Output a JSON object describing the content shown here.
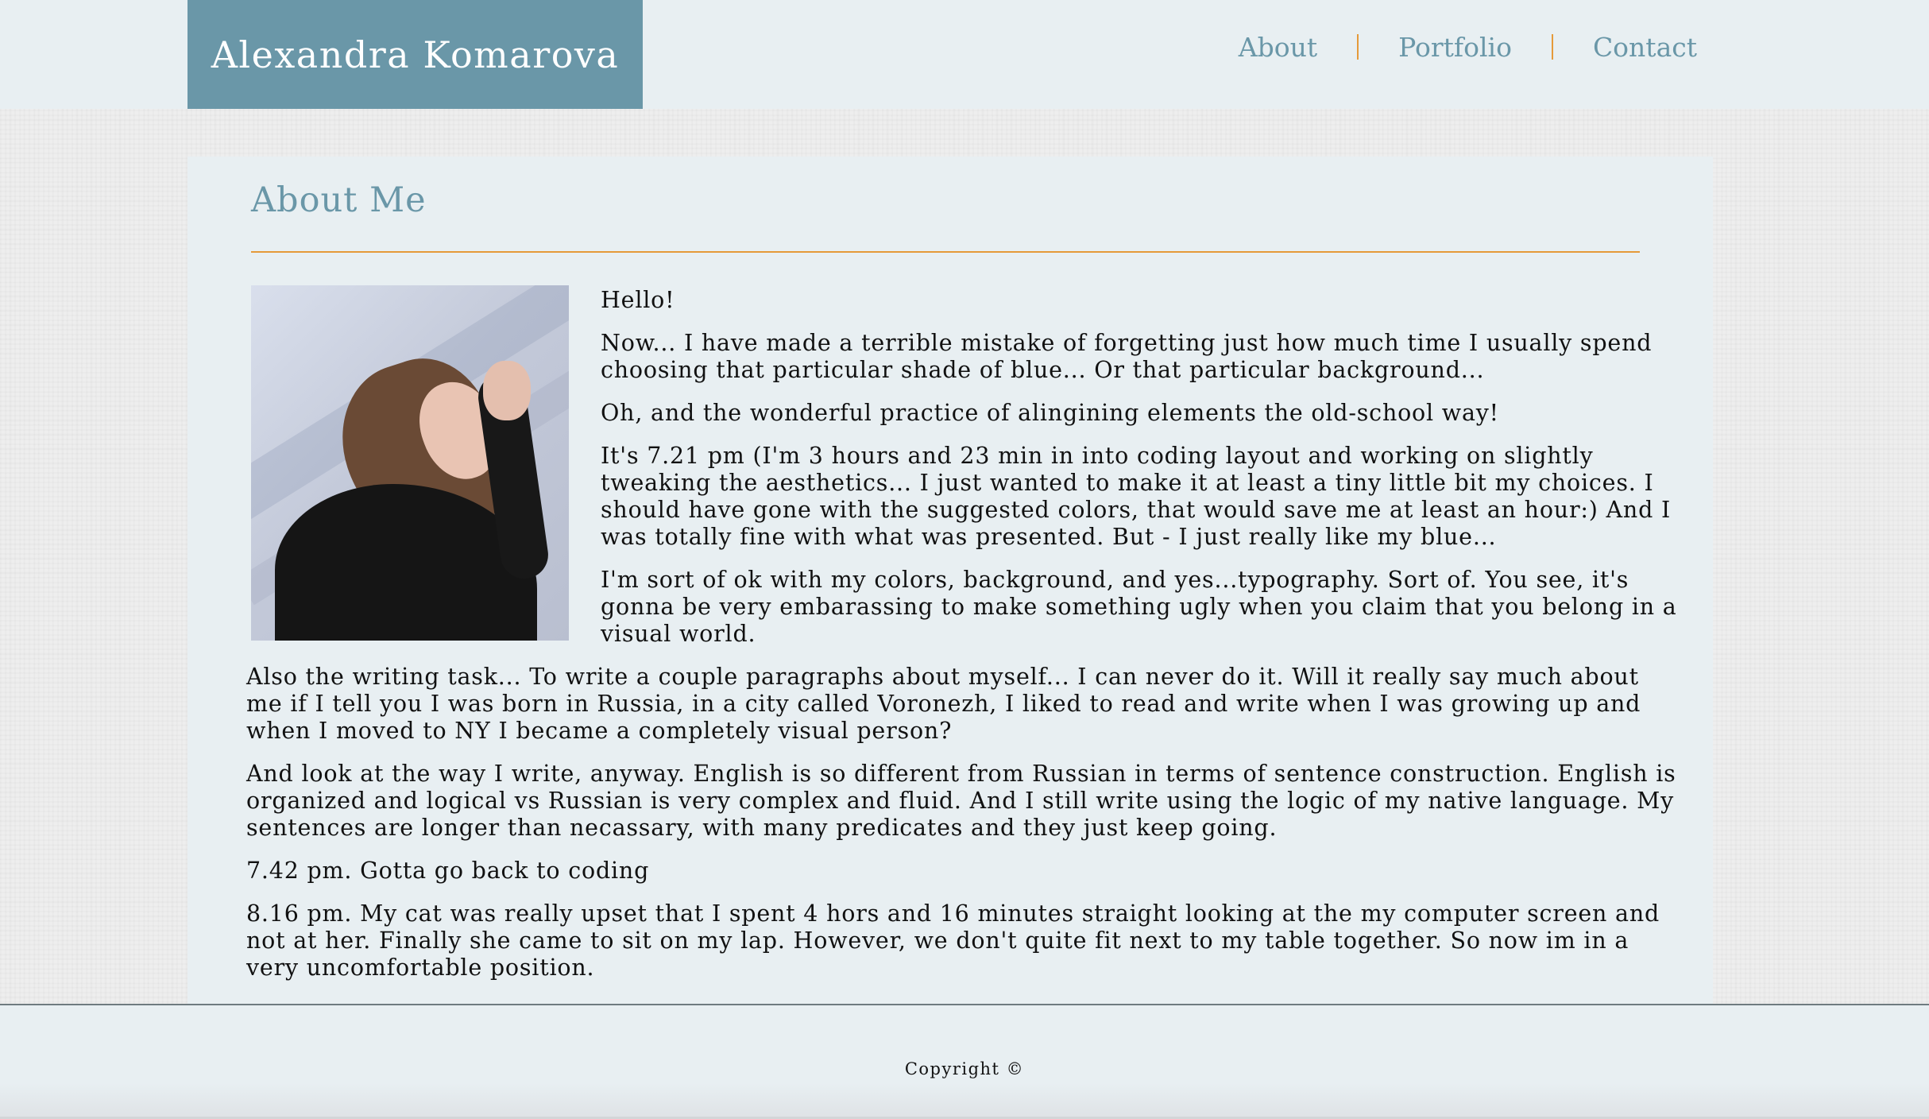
{
  "header": {
    "site_title": "Alexandra Komarova",
    "nav": [
      {
        "label": "About"
      },
      {
        "label": "Portfolio"
      },
      {
        "label": "Contact"
      }
    ]
  },
  "main": {
    "title": "About Me",
    "paragraphs": [
      "Hello!",
      "Now... I have made a terrible mistake of forgetting just how much time I usually spend choosing that particular shade of blue... Or that particular background...",
      "Oh, and the wonderful practice of alingining elements the old-school way!",
      "It's 7.21 pm (I'm 3 hours and 23 min in into coding layout and working on slightly tweaking the aesthetics... I just wanted to make it at least a tiny little bit my choices. I should have gone with the suggested colors, that would save me at least an hour:) And I was totally fine with what was presented. But - I just really like my blue...",
      "I'm sort of ok with my colors, background, and yes...typography. Sort of. You see, it's gonna be very embarassing to make something ugly when you claim that you belong in a visual world.",
      "Also the writing task... To write a couple paragraphs about myself... I can never do it. Will it really say much about me if I tell you I was born in Russia, in a city called Voronezh, I liked to read and write when I was growing up and when I moved to NY I became a completely visual person?",
      "And look at the way I write, anyway. English is so different from Russian in terms of sentence construction. English is organized and logical vs Russian is very complex and fluid. And I still write using the logic of my native language. My sentences are longer than necassary, with many predicates and they just keep going.",
      "7.42 pm. Gotta go back to coding",
      "8.16 pm. My cat was really upset that I spent 4 hors and 16 minutes straight looking at the my computer screen and not at her. Finally she came to sit on my lap. However, we don't quite fit next to my table together. So now im in a very uncomfortable position."
    ]
  },
  "footer": {
    "copyright": "Copyright ©"
  },
  "colors": {
    "accent_blue": "#6a97a8",
    "accent_orange": "#e59a3a",
    "panel_background": "#e8eff2"
  }
}
